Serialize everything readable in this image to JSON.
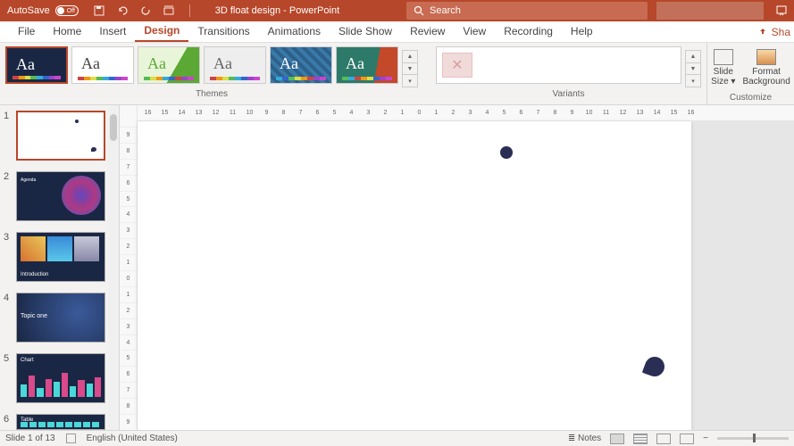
{
  "titlebar": {
    "autosave_label": "AutoSave",
    "autosave_state": "Off",
    "doc_name": "3D float design",
    "app_name": "PowerPoint",
    "search_placeholder": "Search"
  },
  "tabs": {
    "file": "File",
    "home": "Home",
    "insert": "Insert",
    "design": "Design",
    "transitions": "Transitions",
    "animations": "Animations",
    "slideshow": "Slide Show",
    "review": "Review",
    "view": "View",
    "recording": "Recording",
    "help": "Help",
    "share": "Sha"
  },
  "ribbon": {
    "themes_label": "Themes",
    "variants_label": "Variants",
    "customize_label": "Customize",
    "slide_size": "Slide\nSize",
    "format_bg": "Format\nBackground",
    "theme_glyph": "Aa"
  },
  "thumbs": [
    {
      "num": "1",
      "title": ""
    },
    {
      "num": "2",
      "title": "Agenda"
    },
    {
      "num": "3",
      "title": "Introduction"
    },
    {
      "num": "4",
      "title": "Topic one"
    },
    {
      "num": "5",
      "title": "Chart"
    },
    {
      "num": "6",
      "title": "Table"
    }
  ],
  "hruler_marks": [
    "16",
    "15",
    "14",
    "13",
    "12",
    "11",
    "10",
    "9",
    "8",
    "7",
    "6",
    "5",
    "4",
    "3",
    "2",
    "1",
    "0",
    "1",
    "2",
    "3",
    "4",
    "5",
    "6",
    "7",
    "8",
    "9",
    "10",
    "11",
    "12",
    "13",
    "14",
    "15",
    "16"
  ],
  "vruler_marks": [
    "9",
    "8",
    "7",
    "6",
    "5",
    "4",
    "3",
    "2",
    "1",
    "0",
    "1",
    "2",
    "3",
    "4",
    "5",
    "6",
    "7",
    "8",
    "9"
  ],
  "status": {
    "slide_info": "Slide 1 of 13",
    "language": "English (United States)",
    "notes": "Notes"
  }
}
